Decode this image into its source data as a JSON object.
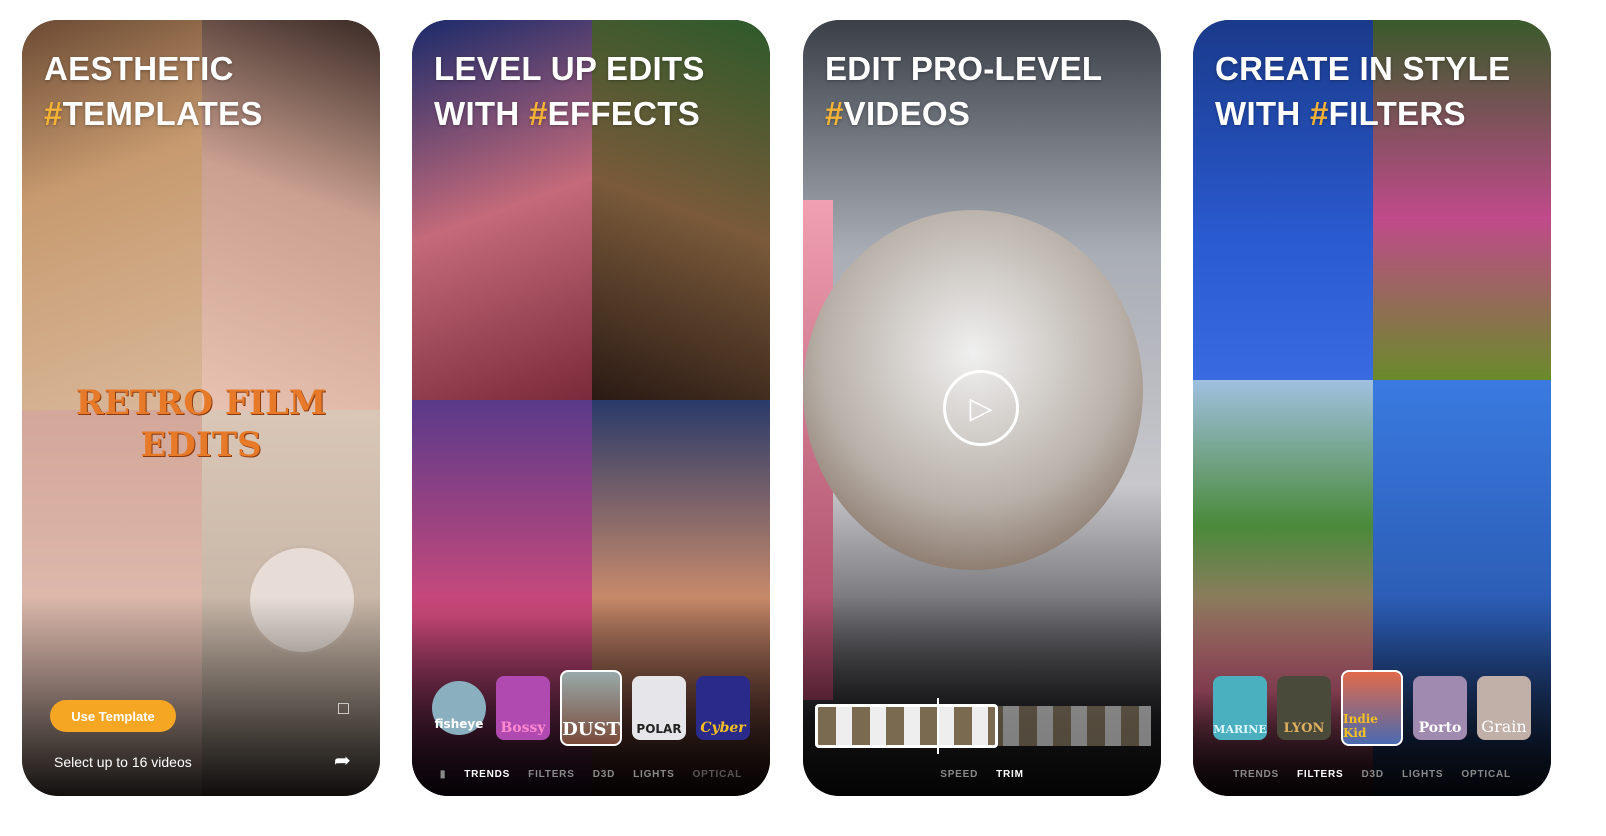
{
  "cards": [
    {
      "headline_1": "AESTHETIC",
      "headline_2_hash": "#",
      "headline_2": "TEMPLATES",
      "overlay_text_1": "RETRO FILM",
      "overlay_text_2": "EDITS",
      "button": "Use Template",
      "footer": "Select up to 16 videos",
      "icons": [
        "bookmark-icon",
        "share-icon"
      ]
    },
    {
      "headline_1": "LEVEL UP EDITS",
      "headline_2_prefix": "WITH ",
      "headline_2_hash": "#",
      "headline_2": "EFFECTS",
      "thumbnails": [
        "fisheye",
        "Bossy",
        "DUST",
        "POLAR",
        "Cyber"
      ],
      "selected": "DUST",
      "tabs": [
        "TRENDS",
        "FILTERS",
        "D3D",
        "LIGHTS",
        "OPTICAL"
      ],
      "active_tab": "TRENDS"
    },
    {
      "headline_1": "EDIT PRO-LEVEL",
      "headline_2_hash": "#",
      "headline_2": "VIDEOS",
      "tabs": [
        "SPEED",
        "TRIM"
      ],
      "active_tab": "TRIM",
      "icons": [
        "play-icon"
      ]
    },
    {
      "headline_1": "CREATE IN STYLE",
      "headline_2_prefix": "WITH ",
      "headline_2_hash": "#",
      "headline_2": "FILTERS",
      "thumbnails": [
        "MARINE",
        "LYON",
        "Indie Kid",
        "Porto",
        "Grain"
      ],
      "selected": "Indie Kid",
      "tabs": [
        "TRENDS",
        "FILTERS",
        "D3D",
        "LIGHTS",
        "OPTICAL"
      ],
      "active_tab": "FILTERS"
    }
  ],
  "colors": {
    "accent": "#f5b335",
    "button": "#f5a623"
  }
}
